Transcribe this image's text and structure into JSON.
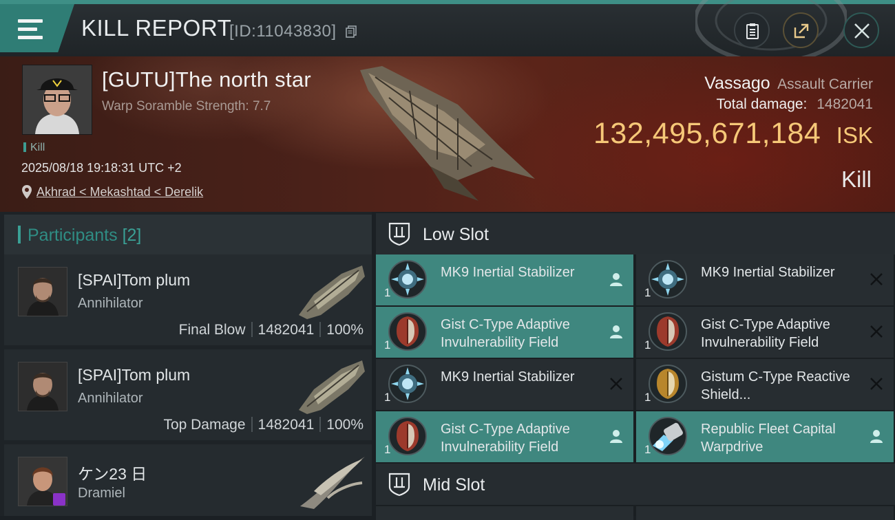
{
  "header": {
    "title": "KILL REPORT",
    "report_id": "[ID:11043830]"
  },
  "victim": {
    "name": "[GUTU]The north star",
    "warp_scramble": "Warp Soramble Strength: 7.7",
    "tag": "Kill",
    "datetime": "2025/08/18 19:18:31 UTC +2",
    "location": "Akhrad < Mekashtad < Derelik",
    "ship_name": "Vassago",
    "ship_class": "Assault Carrier",
    "total_damage_label": "Total damage:",
    "total_damage": "1482041",
    "isk_value": "132,495,671,184",
    "isk_unit": "ISK",
    "result": "Kill"
  },
  "participants": {
    "title": "Participants",
    "count": "[2]",
    "rows": [
      {
        "name": "[SPAI]Tom plum",
        "ship": "Annihilator",
        "role": "Final Blow",
        "damage": "1482041",
        "percent": "100%"
      },
      {
        "name": "[SPAI]Tom plum",
        "ship": "Annihilator",
        "role": "Top Damage",
        "damage": "1482041",
        "percent": "100%"
      },
      {
        "name": "ケン23 日",
        "ship": "Dramiel"
      }
    ]
  },
  "slots": {
    "low_title": "Low Slot",
    "mid_title": "Mid Slot",
    "low_modules": [
      {
        "name": "MK9 Inertial Stabilizer",
        "qty": "1",
        "icon": "stabilizer-icon",
        "state": "person-icon"
      },
      {
        "name": "MK9 Inertial Stabilizer",
        "qty": "1",
        "icon": "stabilizer-icon",
        "state": "close-icon"
      },
      {
        "name": "Gist C-Type Adaptive Invulnerability Field",
        "qty": "1",
        "icon": "shield-icon",
        "state": "person-icon"
      },
      {
        "name": "Gist C-Type Adaptive Invulnerability Field",
        "qty": "1",
        "icon": "shield-icon",
        "state": "close-icon"
      },
      {
        "name": "MK9 Inertial Stabilizer",
        "qty": "1",
        "icon": "stabilizer-icon",
        "state": "close-icon"
      },
      {
        "name": "Gistum C-Type Reactive Shield...",
        "qty": "1",
        "icon": "gold-shield-icon",
        "state": "close-icon"
      },
      {
        "name": "Gist C-Type Adaptive Invulnerability Field",
        "qty": "1",
        "icon": "shield-icon",
        "state": "person-icon"
      },
      {
        "name": "Republic Fleet Capital Warpdrive",
        "qty": "1",
        "icon": "warpdrive-icon",
        "state": "person-icon"
      }
    ]
  },
  "colors": {
    "accent": "#3f877f",
    "isk": "#f6c878",
    "banner": "#4a2119"
  }
}
